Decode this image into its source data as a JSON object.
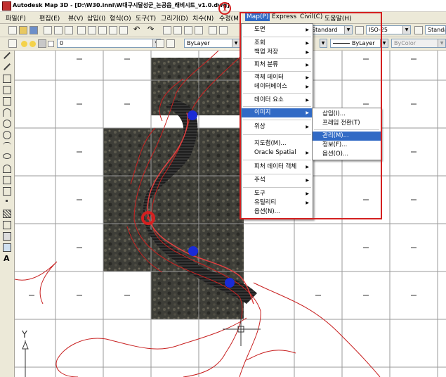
{
  "window": {
    "title": "Autodesk Map 3D - [D:\\W30.inni\\W대구시달성군_논공읍_래비시트_v1.0.dwg]"
  },
  "menubar": {
    "items": [
      "파일(F)",
      "편집(E)",
      "뷰(V)",
      "삽입(I)",
      "형식(O)",
      "도구(T)",
      "그리기(D)",
      "치수(N)",
      "수정(M)",
      "Map(P)",
      "Express",
      "Civil(C)",
      "도움말(H)"
    ]
  },
  "toolbar": {
    "style_combo": "Standard",
    "dim_combo": "ISO-25",
    "text_style_combo": "Standard",
    "layer_combo": "0",
    "color_combo": "ByLayer",
    "linetype_combo": "ByLayer",
    "lineweight_combo": "ByLayer",
    "plot_combo": "ByColor"
  },
  "callout": {
    "number": "1"
  },
  "map_menu": {
    "items": [
      {
        "label": "도면",
        "submenu": true
      },
      {
        "label": "조회",
        "submenu": true
      },
      {
        "label": "백업 저장",
        "submenu": true
      },
      {
        "label": "피처 분류",
        "submenu": true
      },
      {
        "label": "객체 데이터",
        "submenu": true
      },
      {
        "label": "데이터베이스",
        "submenu": true
      },
      {
        "label": "데이터 요소",
        "submenu": true
      },
      {
        "label": "이미지",
        "submenu": true,
        "highlighted": true
      },
      {
        "label": "위상",
        "submenu": true
      },
      {
        "label": "지도첩(M)...",
        "submenu": false
      },
      {
        "label": "Oracle Spatial",
        "submenu": true
      },
      {
        "label": "피처 데이터 객체",
        "submenu": true
      },
      {
        "label": "주석",
        "submenu": true
      },
      {
        "label": "도구",
        "submenu": true
      },
      {
        "label": "유틸리티",
        "submenu": true
      },
      {
        "label": "옵션(N)...",
        "submenu": false
      }
    ]
  },
  "image_submenu": {
    "items": [
      {
        "label": "삽입(I)..."
      },
      {
        "label": "프레임 전환(T)"
      },
      {
        "label": "관리(M)...",
        "highlighted": true
      },
      {
        "label": "정보(F)..."
      },
      {
        "label": "옵션(O)..."
      }
    ]
  },
  "ucs": {
    "y_label": "Y"
  },
  "colors": {
    "accent_red": "#d42020",
    "highlight": "#316ac5",
    "point_blue": "#1a2bd6"
  }
}
